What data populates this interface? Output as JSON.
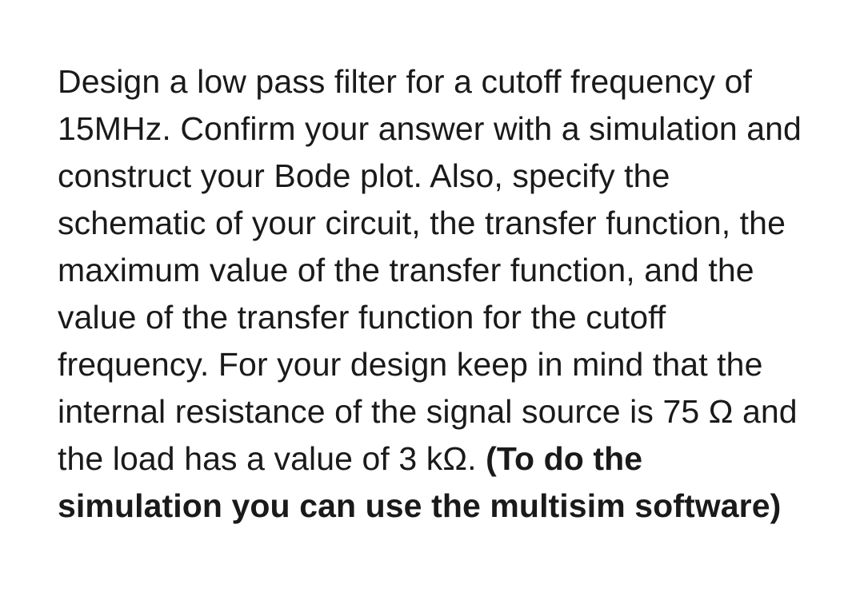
{
  "problem": {
    "body_plain": "Design a low pass filter for a cutoff frequency of 15MHz. Confirm your answer with a simulation and construct your Bode plot. Also, specify the schematic of your circuit, the transfer function, the maximum value of the transfer function, and the value of the transfer function for the cutoff frequency. For your design keep in mind that the internal resistance of the signal source is 75 Ω and the load has a value of 3 kΩ. ",
    "body_bold": "(To do the simulation you can use the multisim software)"
  }
}
